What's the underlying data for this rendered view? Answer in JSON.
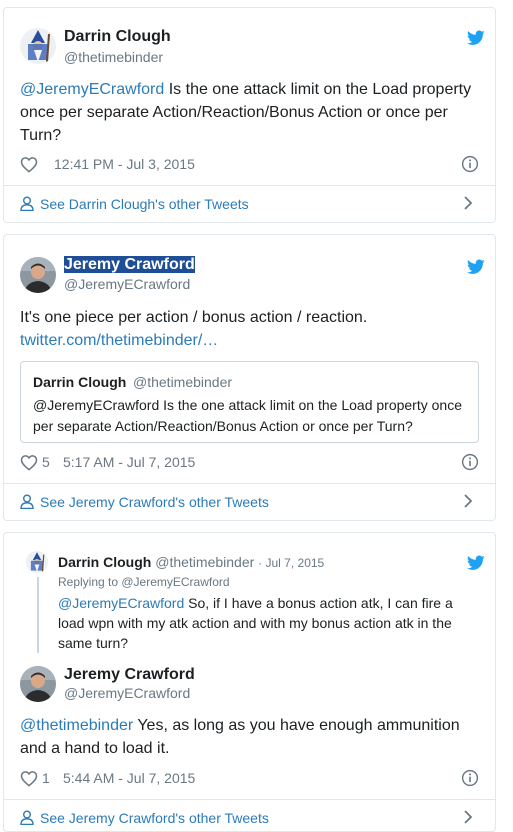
{
  "colors": {
    "accent": "#2b7bb9",
    "twitter_blue": "#1da1f2",
    "muted": "#697882",
    "border": "#e1e8ed"
  },
  "tweet1": {
    "author_name": "Darrin Clough",
    "author_handle": "@thetimebinder",
    "mention": "@JeremyECrawford",
    "text": " Is the one attack limit on the Load property once per separate Action/Reaction/Bonus Action or once per Turn?",
    "like_count": "",
    "timestamp": "12:41 PM - Jul 3, 2015",
    "footer_label": "See Darrin Clough's other Tweets"
  },
  "tweet2": {
    "author_name": "Jeremy Crawford",
    "author_handle": "@JeremyECrawford",
    "text": "It's one piece per action / bonus action / reaction.",
    "link": "twitter.com/thetimebinder/…",
    "quote": {
      "name": "Darrin Clough",
      "handle": "@thetimebinder",
      "text": "@JeremyECrawford Is the one attack limit on the Load property once per separate Action/Reaction/Bonus Action or once per Turn?"
    },
    "like_count": "5",
    "timestamp": "5:17 AM - Jul 7, 2015",
    "footer_label": "See Jeremy Crawford's other Tweets"
  },
  "tweet3": {
    "parent": {
      "name": "Darrin Clough",
      "handle": "@thetimebinder",
      "date": "· Jul 7, 2015",
      "replying_to": "Replying to @JeremyECrawford",
      "mention": "@JeremyECrawford",
      "text": " So, if I have a bonus action atk,  I can fire a load wpn with my atk action and with my bonus action atk in the same turn?"
    },
    "author_name": "Jeremy Crawford",
    "author_handle": "@JeremyECrawford",
    "mention": "@thetimebinder",
    "text": " Yes, as long as you have enough ammunition and a hand to load it.",
    "like_count": "1",
    "timestamp": "5:44 AM - Jul 7, 2015",
    "footer_label": "See Jeremy Crawford's other Tweets"
  }
}
